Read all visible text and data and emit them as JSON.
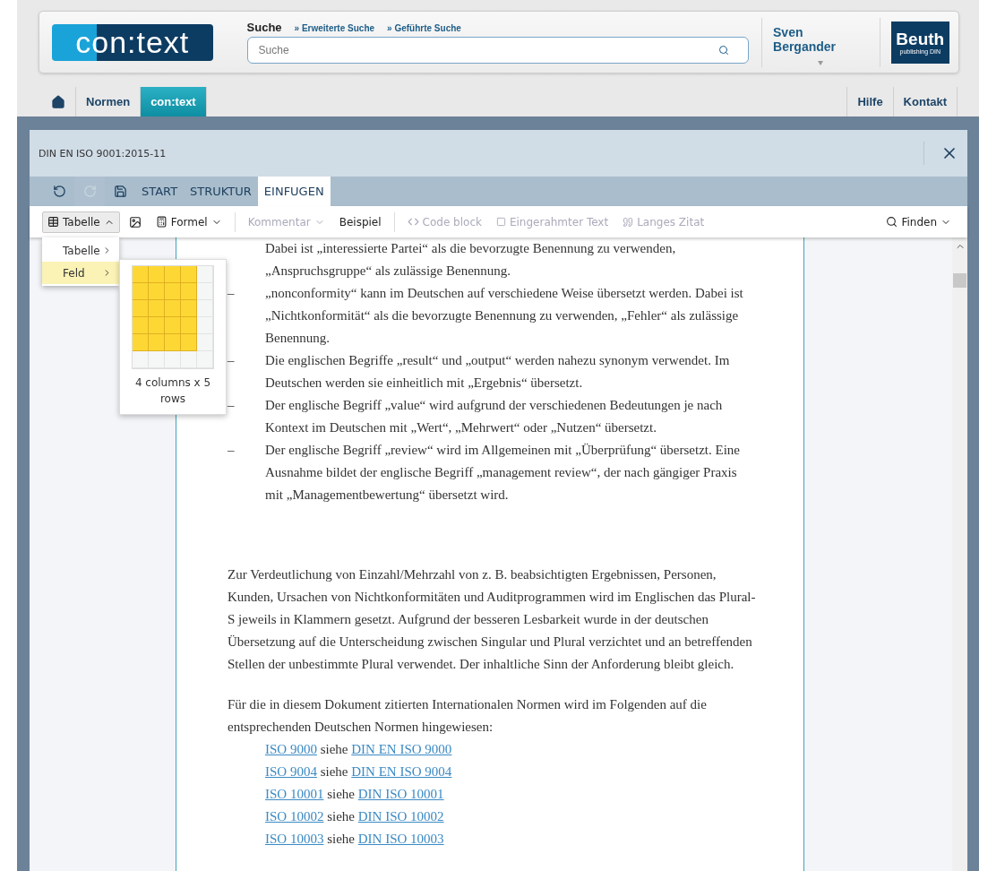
{
  "header": {
    "logo": "con:text",
    "search_label": "Suche",
    "search_links": [
      "Erweiterte Suche",
      "Geführte Suche"
    ],
    "link_marker": "»",
    "search": {
      "placeholder": "Suche"
    },
    "user": "Sven Bergander",
    "publisher": {
      "name": "Beuth",
      "sub": "publishing DIN"
    }
  },
  "nav": {
    "left": [
      {
        "label": "Normen",
        "selected": false
      },
      {
        "label": "con:text",
        "selected": true
      }
    ],
    "right": [
      "Hilfe",
      "Kontakt"
    ]
  },
  "modal": {
    "title": "DIN EN ISO 9001:2015-11",
    "tabs": [
      {
        "label": "START",
        "selected": false
      },
      {
        "label": "STRUKTUR",
        "selected": false
      },
      {
        "label": "EINFUGEN",
        "selected": true
      }
    ],
    "history": [
      {
        "kind": "undo",
        "disabled": false
      },
      {
        "kind": "redo",
        "disabled": true
      },
      {
        "kind": "save",
        "disabled": false
      }
    ],
    "toolbar": [
      {
        "kind": "table",
        "label": "Tabelle",
        "pressed": true,
        "disabled": false,
        "caret": true
      },
      {
        "kind": "image",
        "pressed": false,
        "disabled": false
      },
      {
        "kind": "formula",
        "label": "Formel",
        "pressed": false,
        "disabled": false,
        "caret": true
      },
      {
        "kind": "divider"
      },
      {
        "kind": "text",
        "label": "Kommentar",
        "pressed": false,
        "disabled": true,
        "caret": true
      },
      {
        "kind": "text",
        "label": "Beispiel",
        "pressed": false,
        "disabled": false
      },
      {
        "kind": "divider"
      },
      {
        "kind": "code",
        "label": "Code block",
        "pressed": false,
        "disabled": true
      },
      {
        "kind": "frame",
        "label": "Eingerahmter Text",
        "pressed": false,
        "disabled": true
      },
      {
        "kind": "quote",
        "label": "Langes Zitat",
        "pressed": false,
        "disabled": true
      }
    ],
    "find": "Finden",
    "menu": [
      {
        "label": "Tabelle",
        "selected": false
      },
      {
        "label": "Feld",
        "selected": true
      }
    ],
    "grid": {
      "rows": [
        {
          "cells": [
            {
              "selected": true
            },
            {
              "selected": true
            },
            {
              "selected": true
            },
            {
              "selected": true
            },
            {
              "selected": false
            }
          ]
        },
        {
          "cells": [
            {
              "selected": true
            },
            {
              "selected": true
            },
            {
              "selected": true
            },
            {
              "selected": true
            },
            {
              "selected": false
            }
          ]
        },
        {
          "cells": [
            {
              "selected": true
            },
            {
              "selected": true
            },
            {
              "selected": true
            },
            {
              "selected": true
            },
            {
              "selected": false
            }
          ]
        },
        {
          "cells": [
            {
              "selected": true
            },
            {
              "selected": true
            },
            {
              "selected": true
            },
            {
              "selected": true
            },
            {
              "selected": false
            }
          ]
        },
        {
          "cells": [
            {
              "selected": true
            },
            {
              "selected": true
            },
            {
              "selected": true
            },
            {
              "selected": true
            },
            {
              "selected": false
            }
          ]
        },
        {
          "cells": [
            {
              "selected": false
            },
            {
              "selected": false
            },
            {
              "selected": false
            },
            {
              "selected": false
            },
            {
              "selected": false
            }
          ]
        }
      ],
      "caption": "4 columns x 5 rows"
    },
    "document": {
      "list": [
        {
          "text": "Dabei ist „interessierte Partei“ als die bevorzugte Benennung zu verwenden, „Anspruchsgruppe“ als zulässige Benennung."
        },
        {
          "marker": "–",
          "text": "„nonconformity“ kann im Deutschen auf verschiedene Weise übersetzt werden. Dabei ist „Nichtkonformität“ als die bevorzugte Benennung zu verwenden, „Fehler“ als zulässige Benennung."
        },
        {
          "marker": "–",
          "text": "Die englischen Begriffe „result“ und „output“ werden nahezu synonym verwendet. Im Deutschen werden sie einheitlich mit „Ergebnis“ übersetzt."
        },
        {
          "marker": "–",
          "text": "Der englische Begriff „value“ wird aufgrund der verschiedenen Bedeutungen je nach Kontext im Deutschen mit „Wert“, „Mehrwert“ oder „Nutzen“ übersetzt."
        },
        {
          "marker": "–",
          "text": "Der englische Begriff „review“ wird im Allgemeinen mit „Überprüfung“ übersetzt. Eine Ausnahme bildet der englische Begriff „management review“, der nach gängiger Praxis mit „Managementbewertung“ übersetzt wird."
        }
      ],
      "paragraphs": [
        "Zur Verdeutlichung von Einzahl/Mehrzahl von z. B. beabsichtigten Ergebnissen, Personen, Kunden, Ursachen von Nichtkonformitäten und Auditprogrammen wird im Englischen das Plural-S jeweils in Klammern gesetzt. Aufgrund der besseren Lesbarkeit wurde in der deutschen Übersetzung auf die Unterscheidung zwischen Singular und Plural verzichtet und an betreffenden Stellen der unbestimmte Plural verwendet. Der inhaltliche Sinn der Anforderung bleibt gleich.",
        "Für die in diesem Dokument zitierten Internationalen Normen wird im Folgenden auf die entsprechenden Deutschen Normen hingewiesen:"
      ],
      "references": [
        {
          "iso": "ISO 9000",
          "word": "siehe",
          "din": "DIN EN ISO 9000"
        },
        {
          "iso": "ISO 9004",
          "word": "siehe",
          "din": "DIN EN ISO 9004"
        },
        {
          "iso": "ISO 10001",
          "word": "siehe",
          "din": "DIN ISO 10001"
        },
        {
          "iso": "ISO 10002",
          "word": "siehe",
          "din": "DIN ISO 10002"
        },
        {
          "iso": "ISO 10003",
          "word": "siehe",
          "din": "DIN ISO 10003"
        }
      ]
    }
  }
}
